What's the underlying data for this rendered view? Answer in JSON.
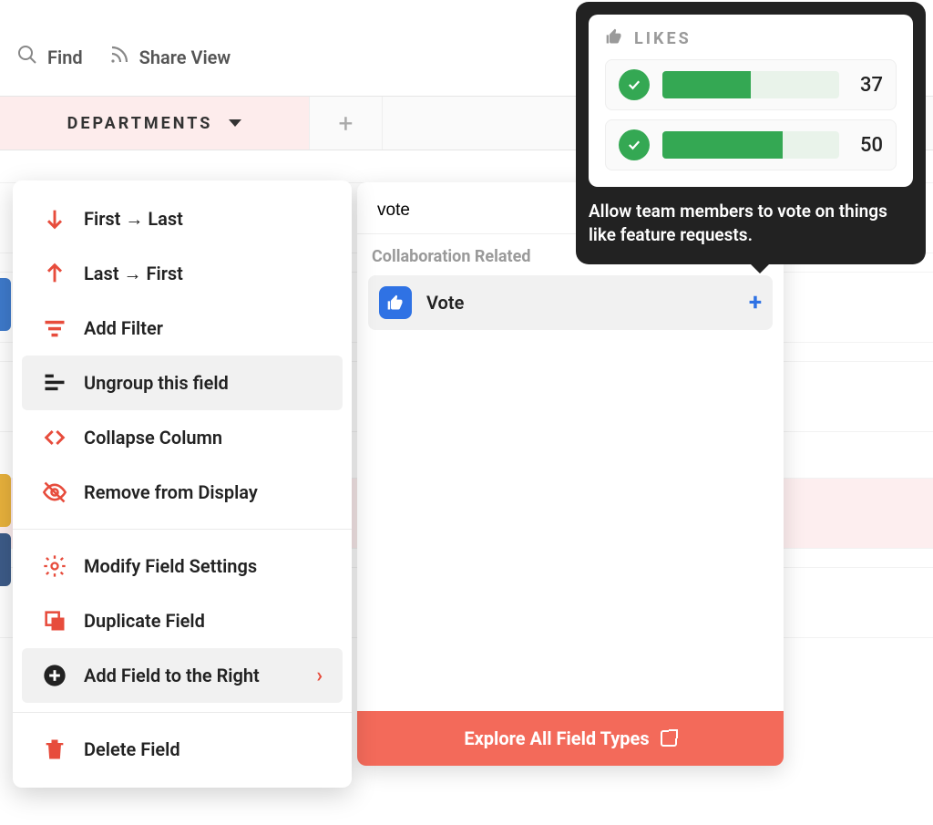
{
  "toolbar": {
    "find": "Find",
    "share": "Share View"
  },
  "column": {
    "name": "DEPARTMENTS"
  },
  "ctx": {
    "first_last": "First → Last",
    "last_first": "Last → First",
    "add_filter": "Add Filter",
    "ungroup": "Ungroup this field",
    "collapse": "Collapse Column",
    "remove": "Remove from Display",
    "modify": "Modify Field Settings",
    "duplicate": "Duplicate Field",
    "add_right": "Add Field to the Right",
    "delete": "Delete Field"
  },
  "picker": {
    "search_value": "vote",
    "section": "Collaboration Related",
    "option_vote": "Vote",
    "footer": "Explore All Field Types"
  },
  "tooltip": {
    "title": "LIKES",
    "rows": [
      {
        "value": "37",
        "pct": 50
      },
      {
        "value": "50",
        "pct": 68
      }
    ],
    "desc": "Allow team members to vote on things like feature requests."
  }
}
